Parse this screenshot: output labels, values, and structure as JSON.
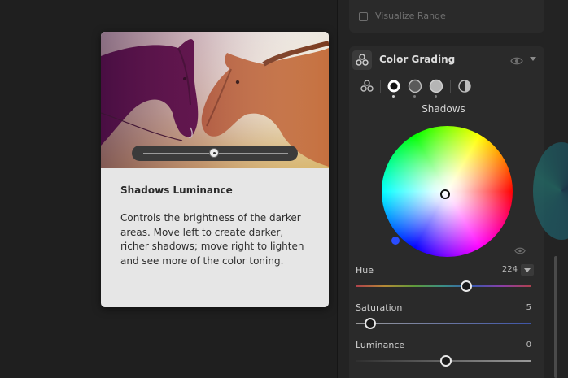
{
  "range_panel": {
    "visualize_range_label": "Visualize Range",
    "visualize_range_checked": false
  },
  "color_grading": {
    "title": "Color Grading",
    "icon": "color-grading-icon",
    "modes": [
      {
        "icon": "three-way-icon",
        "selected": false
      },
      {
        "icon": "shadows-icon",
        "selected": true
      },
      {
        "icon": "midtones-icon",
        "selected": false
      },
      {
        "icon": "highlights-icon",
        "selected": false
      },
      {
        "icon": "global-icon",
        "selected": false
      }
    ],
    "active_region": "Shadows",
    "wheel_handle_color": "#2a4dff",
    "sliders": {
      "hue": {
        "label": "Hue",
        "value": "224",
        "position": 0.63
      },
      "saturation": {
        "label": "Saturation",
        "value": "5",
        "position": 0.08
      },
      "luminance": {
        "label": "Luminance",
        "value": "0",
        "position": 0.5
      }
    }
  },
  "tooltip": {
    "title": "Shadows Luminance",
    "body": "Controls the brightness of the darker areas. Move left to create darker, richer shadows; move right to lighten and see more of the color toning.",
    "preview_image": "two-horses-photo",
    "preview_slider_position": 0.5
  },
  "colors": {
    "panel_bg": "#2a2a2a",
    "tooltip_bg": "#e6e6e6",
    "accent_blue": "#2a4dff"
  }
}
